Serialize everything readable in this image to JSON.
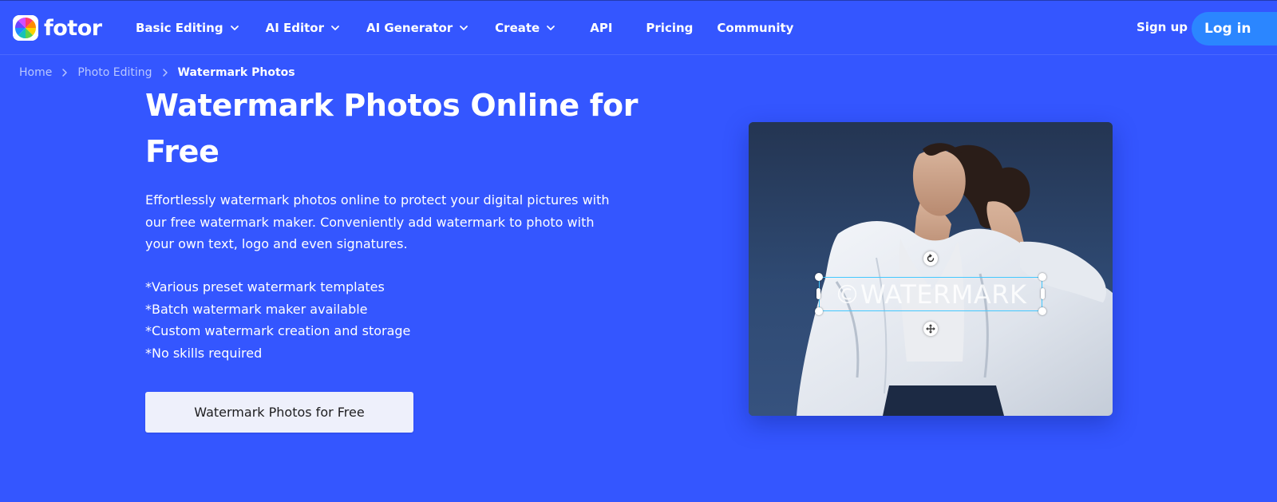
{
  "header": {
    "logo_text": "fotor",
    "nav": [
      {
        "label": "Basic Editing",
        "has_dropdown": true
      },
      {
        "label": "AI Editor",
        "has_dropdown": true
      },
      {
        "label": "AI Generator",
        "has_dropdown": true
      },
      {
        "label": "Create",
        "has_dropdown": true
      },
      {
        "label": "API",
        "has_dropdown": false
      },
      {
        "label": "Pricing",
        "has_dropdown": false
      },
      {
        "label": "Community",
        "has_dropdown": false
      }
    ],
    "sign_up": "Sign up",
    "log_in": "Log in"
  },
  "breadcrumb": {
    "items": [
      "Home",
      "Photo Editing"
    ],
    "current": "Watermark Photos"
  },
  "hero": {
    "title": "Watermark Photos Online for Free",
    "description": "Effortlessly watermark photos online to protect your digital pictures with our free watermark maker. Conveniently add watermark to photo with your own text, logo and even signatures.",
    "features": [
      "*Various preset watermark templates",
      "*Batch watermark maker available",
      "*Custom watermark creation and storage",
      "*No skills required"
    ],
    "cta": "Watermark Photos for Free"
  },
  "preview": {
    "watermark_text": "©WATERMARK"
  },
  "colors": {
    "background": "#3456ff",
    "login_button": "#2b86ff",
    "cta_background": "#eef0fb",
    "selection_border": "#43c8ff"
  }
}
